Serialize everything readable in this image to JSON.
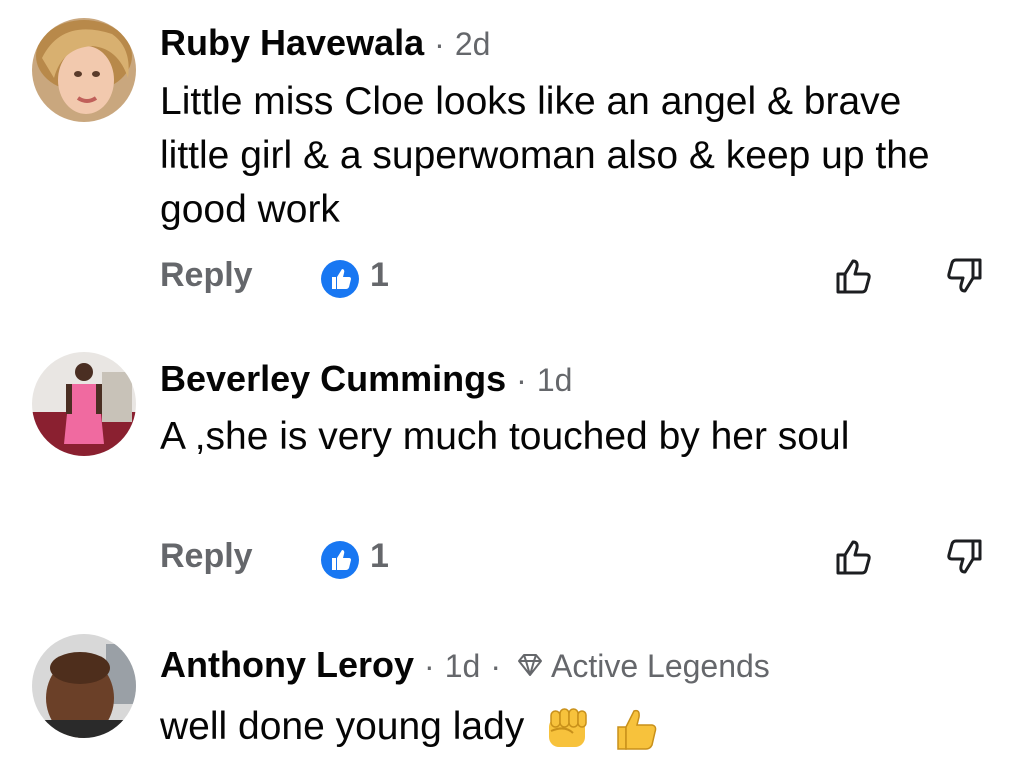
{
  "comments": [
    {
      "author": "Ruby Havewala",
      "separator": "·",
      "time": "2d",
      "text": "Little miss Cloe looks like an angel & brave little girl & a superwoman also & keep up the good work",
      "reply_label": "Reply",
      "like_count": "1",
      "avatar_icon": "profile-photo-woman"
    },
    {
      "author": "Beverley Cummings",
      "separator": "·",
      "time": "1d",
      "text": "A  ,she is very much touched by her soul",
      "reply_label": "Reply",
      "like_count": "1",
      "avatar_icon": "profile-photo-woman-pink-dress"
    },
    {
      "author": "Anthony Leroy",
      "separator": "·",
      "time": "1d",
      "badge": "Active Legends",
      "text": "well done young lady",
      "emojis": [
        "raised-fist-emoji",
        "thumbs-up-emoji"
      ],
      "avatar_icon": "profile-photo-man"
    }
  ],
  "colors": {
    "accent_blue": "#1877f2",
    "secondary_text": "#65676b",
    "primary_text": "#050505"
  }
}
